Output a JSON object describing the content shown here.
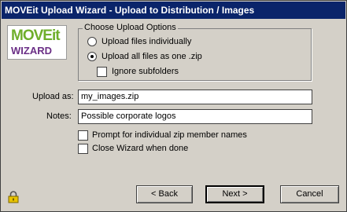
{
  "window": {
    "title": "MOVEit Upload Wizard - Upload to Distribution / Images"
  },
  "logo": {
    "line1": "MOVEit",
    "line2": "WIZARD"
  },
  "upload_options": {
    "legend": "Choose Upload Options",
    "individually_label": "Upload files individually",
    "zip_label": "Upload all files as one .zip",
    "ignore_subfolders_label": "Ignore subfolders",
    "selected": "zip"
  },
  "form": {
    "upload_as_label": "Upload as:",
    "upload_as_value": "my_images.zip",
    "notes_label": "Notes:",
    "notes_value": "Possible corporate logos"
  },
  "checkboxes": {
    "prompt_label": "Prompt for individual zip member names",
    "close_label": "Close Wizard when done"
  },
  "buttons": {
    "back": "< Back",
    "next": "Next >",
    "cancel": "Cancel"
  },
  "icons": {
    "lock": "lock-icon"
  }
}
